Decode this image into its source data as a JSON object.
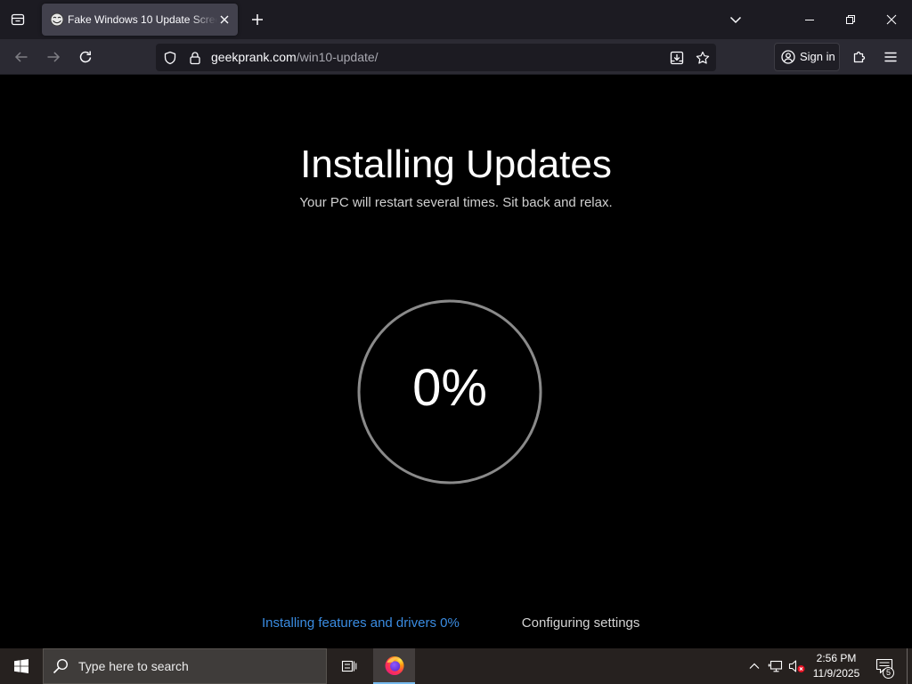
{
  "browser": {
    "tabs": [
      {
        "title": "Fake Windows 10 Update Scree",
        "favicon": "trollface-icon",
        "active": true
      }
    ],
    "tab_strip_icons": [
      "firefox-view-icon",
      "plus-icon",
      "chevron-down-icon",
      "minimize-icon",
      "restore-icon",
      "close-icon"
    ],
    "toolbar": {
      "back_enabled": false,
      "forward_enabled": false,
      "icons": [
        "back-arrow-icon",
        "forward-arrow-icon",
        "reload-icon",
        "puzzle-piece-icon",
        "hamburger-menu-icon"
      ],
      "sign_in_label": "Sign in",
      "sign_in_icon": "account-icon"
    },
    "url_bar": {
      "domain": "geekprank.com",
      "path": "/win10-update/",
      "icons": [
        "shield-icon",
        "lock-icon",
        "install-icon",
        "star-icon"
      ]
    },
    "colors": {
      "tab_strip": "#1c1b22",
      "toolbar": "#2b2a33",
      "active_tab": "#42414d",
      "url_path": "#a8a8b0"
    }
  },
  "page": {
    "title": "Installing Updates",
    "subtitle": "Your PC will restart several times. Sit back and relax.",
    "progress": {
      "value": 0,
      "label": "0%"
    },
    "steps": [
      {
        "label": "Installing features and drivers 0%",
        "current": true
      },
      {
        "label": "Configuring settings",
        "current": false
      }
    ],
    "colors": {
      "background": "#000000",
      "current_step": "#3a8ce2",
      "pending_step": "#d4d4d4",
      "ring_track": "#8a8a8a",
      "ring_fill": "#ffffff"
    }
  },
  "taskbar": {
    "start_icon": "windows-logo-icon",
    "search": {
      "placeholder": "Type here to search",
      "icon": "search-icon"
    },
    "task_view_icon": "task-view-icon",
    "pinned_apps": [
      {
        "icon": "firefox-icon",
        "active": true
      }
    ],
    "tray": {
      "icons": [
        "chevron-up-icon",
        "network-icon",
        "volume-muted-icon"
      ],
      "clock": {
        "time": "2:56 PM",
        "date": "11/9/2025"
      },
      "notifications": {
        "icon": "notification-icon",
        "count": "5"
      }
    },
    "colors": {
      "background": "#26211f",
      "search_box": "#3f3c3a",
      "active_indicator": "#76b9ed"
    }
  }
}
